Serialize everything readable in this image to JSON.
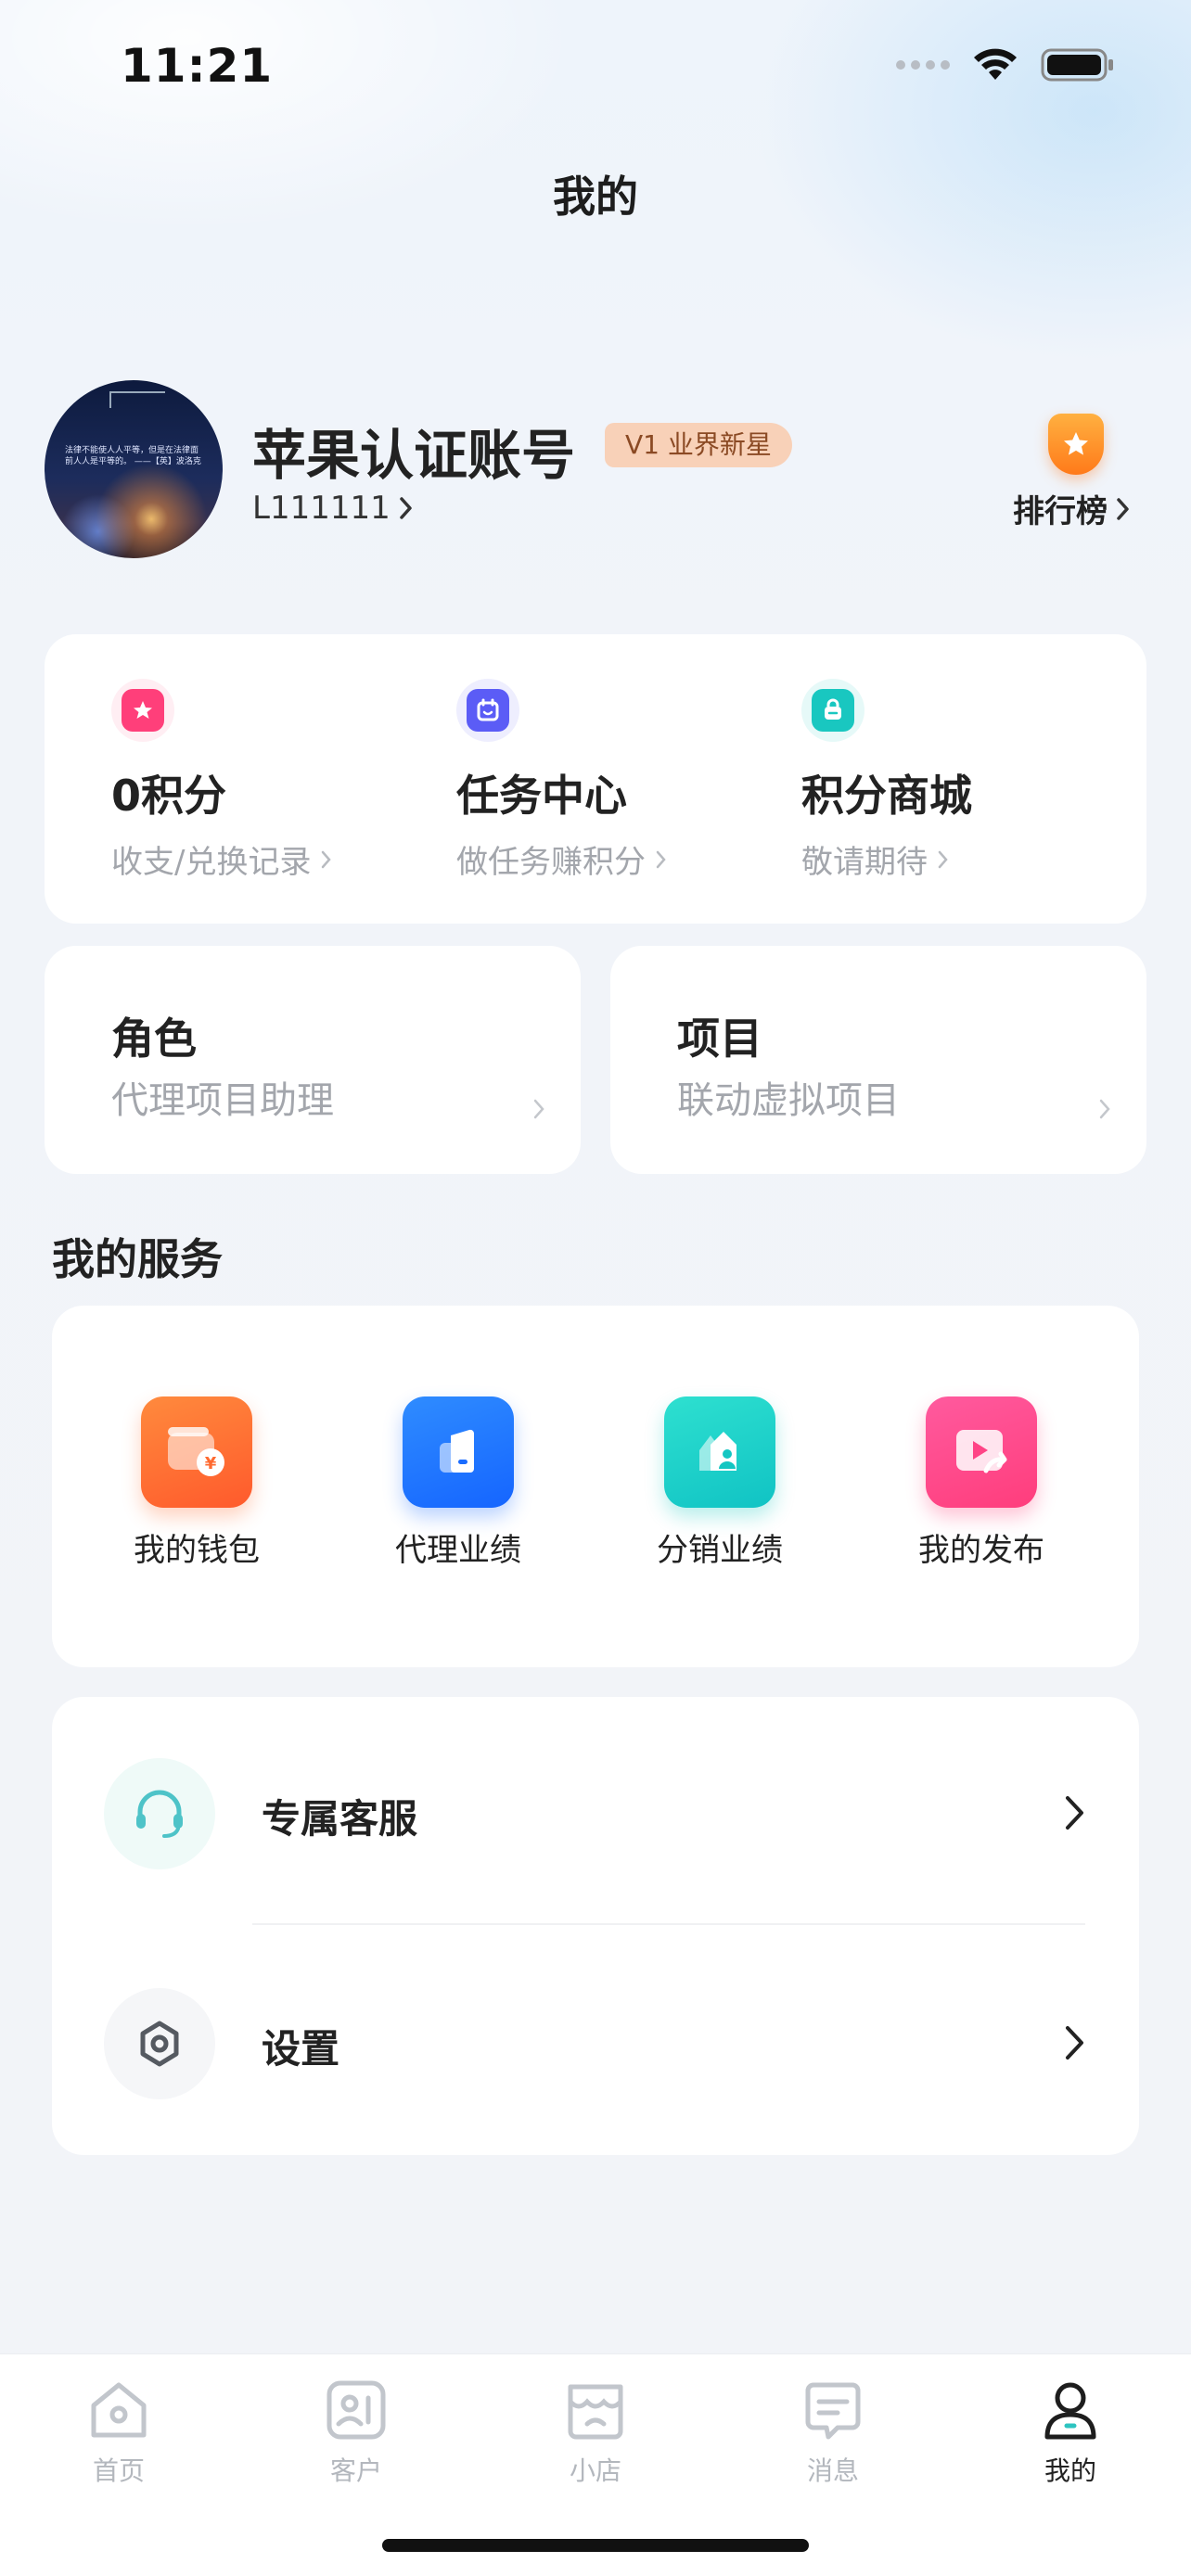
{
  "status_bar": {
    "time": "11:21"
  },
  "page": {
    "title": "我的"
  },
  "profile": {
    "name": "苹果认证账号",
    "level_badge": "V1 业界新星",
    "id_text": "L111111",
    "avatar_caption": "法律不能使人人平等，但是在法律面前人人是平等的。 ——【英】波洛克",
    "rank_label": "排行榜"
  },
  "points": [
    {
      "title": "0积分",
      "subtitle": "收支/兑换记录",
      "icon": "star-badge-icon",
      "color": "#ff3f7a"
    },
    {
      "title": "任务中心",
      "subtitle": "做任务赚积分",
      "icon": "calendar-task-icon",
      "color": "#5b5cf6"
    },
    {
      "title": "积分商城",
      "subtitle": "敬请期待",
      "icon": "shopping-bag-icon",
      "color": "#19c7c0"
    }
  ],
  "role_card": {
    "title": "角色",
    "value": "代理项目助理"
  },
  "project_card": {
    "title": "项目",
    "value": "联动虚拟项目"
  },
  "services": {
    "title": "我的服务",
    "items": [
      {
        "label": "我的钱包",
        "icon": "wallet-icon"
      },
      {
        "label": "代理业绩",
        "icon": "agent-performance-icon"
      },
      {
        "label": "分销业绩",
        "icon": "distribution-performance-icon"
      },
      {
        "label": "我的发布",
        "icon": "my-publish-icon"
      }
    ]
  },
  "menu": [
    {
      "label": "专属客服",
      "icon": "headset-icon"
    },
    {
      "label": "设置",
      "icon": "settings-hexagon-icon"
    }
  ],
  "tabs": [
    {
      "label": "首页",
      "icon": "home-icon",
      "active": false
    },
    {
      "label": "客户",
      "icon": "customer-icon",
      "active": false
    },
    {
      "label": "小店",
      "icon": "shop-icon",
      "active": false
    },
    {
      "label": "消息",
      "icon": "message-icon",
      "active": false
    },
    {
      "label": "我的",
      "icon": "profile-icon",
      "active": true
    }
  ],
  "colors": {
    "accent_orange": "#ff7a1a",
    "badge_bg": "#f8d1b8",
    "muted_text": "#a3a6ac"
  }
}
